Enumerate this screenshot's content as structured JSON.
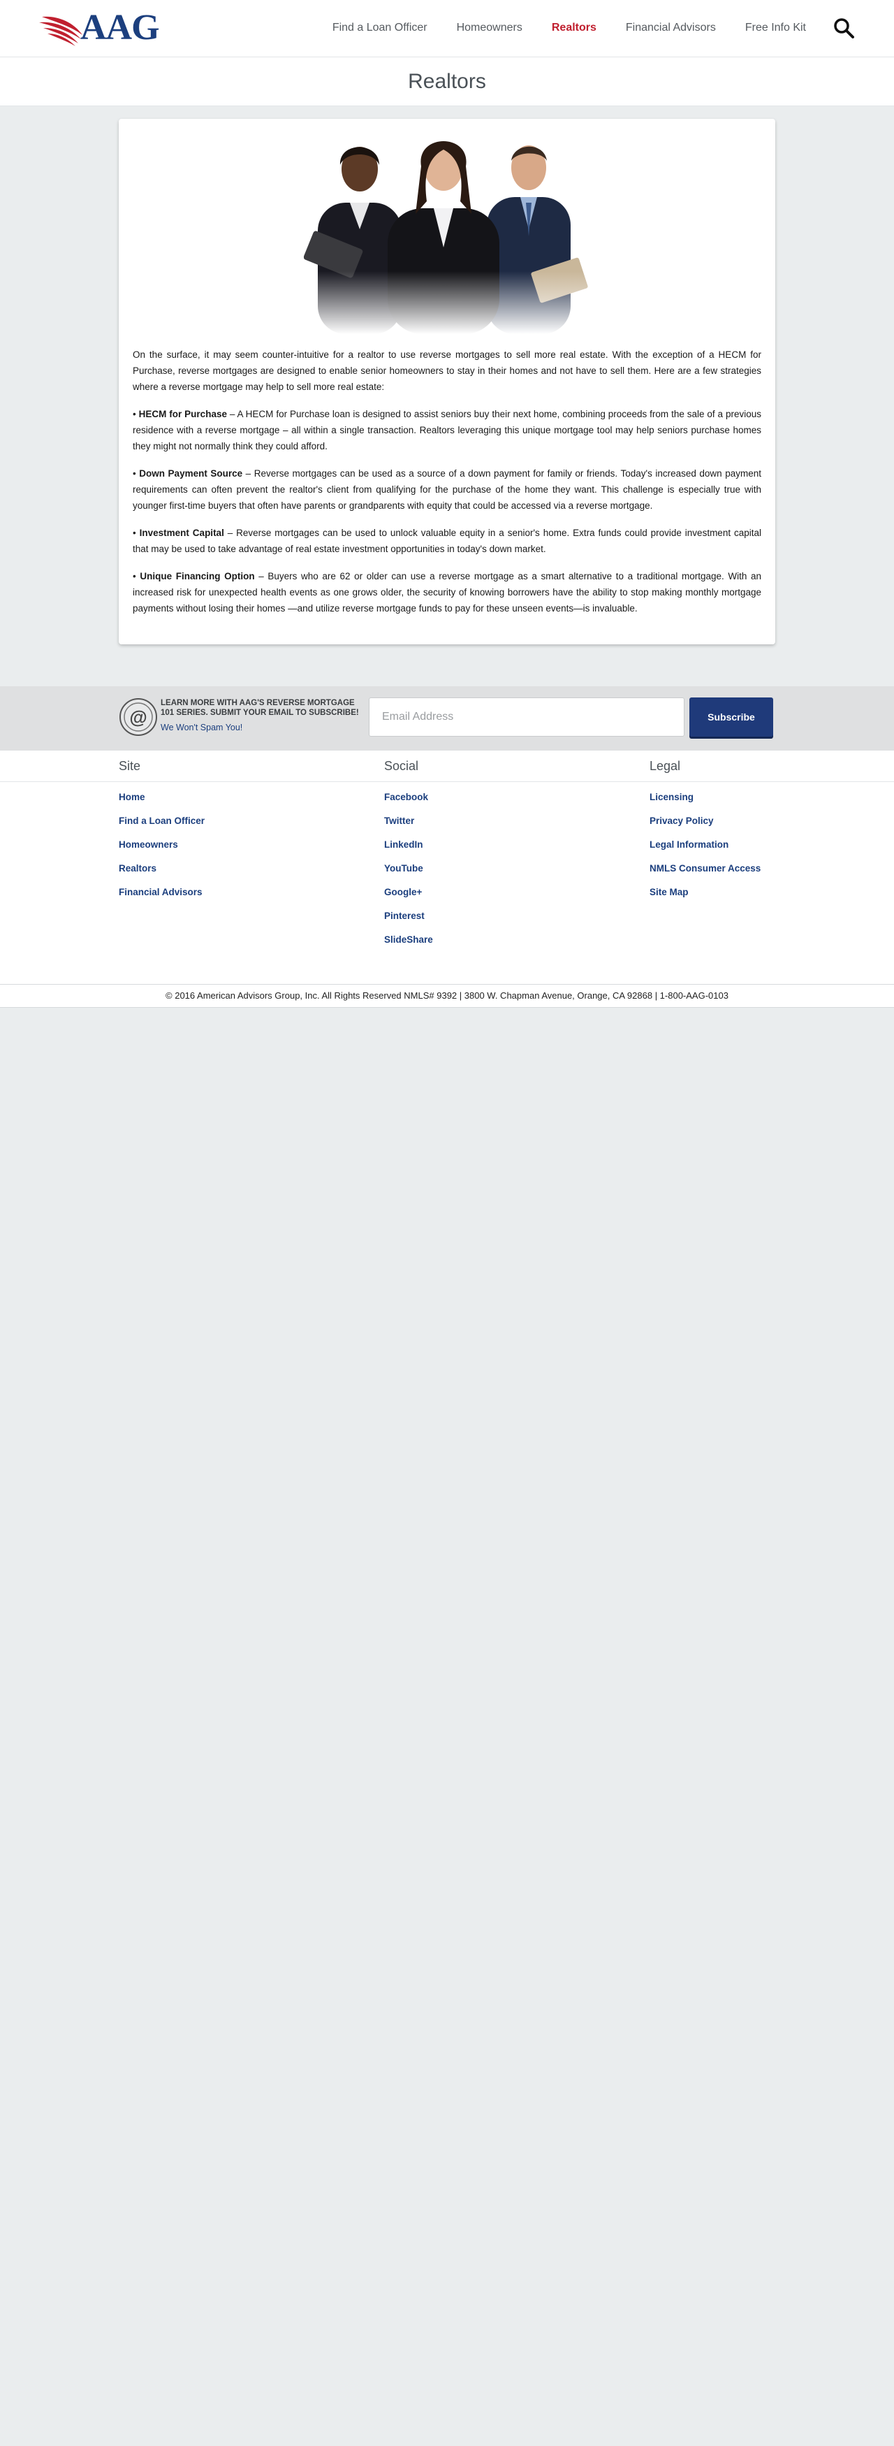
{
  "header": {
    "logo_text": "AAG",
    "nav": [
      {
        "label": "Find a Loan Officer",
        "active": false
      },
      {
        "label": "Homeowners",
        "active": false
      },
      {
        "label": "Realtors",
        "active": true
      },
      {
        "label": "Financial Advisors",
        "active": false
      },
      {
        "label": "Free Info Kit",
        "active": false
      }
    ],
    "search_icon": "search-icon"
  },
  "page": {
    "title": "Realtors"
  },
  "article": {
    "intro": "On the surface, it may seem counter-intuitive for a realtor to use reverse mortgages to sell more real estate. With the exception of a HECM for Purchase, reverse mortgages are designed to enable senior homeowners to stay in their homes and not have to sell them. Here are a few strategies where a reverse mortgage may help to sell more real estate:",
    "items": [
      {
        "bullet": "•",
        "heading": "HECM for Purchase",
        "text": " – A HECM for Purchase loan is designed to assist seniors buy their next home, combining proceeds from the sale of a previous residence with a reverse mortgage – all within a single transaction. Realtors leveraging this unique mortgage tool may help seniors purchase homes they might not normally think they could afford."
      },
      {
        "bullet": "•",
        "heading": "Down Payment Source",
        "text": " – Reverse mortgages can be used as a source of a down payment for family or friends. Today's increased down payment requirements can often prevent the realtor's client from qualifying for the purchase of the home they want. This challenge is especially true with younger first-time buyers that often have parents or grandparents with equity that could be accessed via a reverse mortgage."
      },
      {
        "bullet": "•",
        "heading": "Investment Capital",
        "text": " – Reverse mortgages can be used to unlock valuable equity in a senior's home. Extra funds could provide investment capital that may be used to take advantage of real estate investment opportunities in today's down market."
      },
      {
        "bullet": "•",
        "heading": "Unique Financing Option",
        "text": " – Buyers who are 62 or older can use a reverse mortgage as a smart alternative to a traditional mortgage. With an increased risk for unexpected health events as one grows older, the security of knowing borrowers have the ability to stop making monthly mortgage payments without losing their homes —and utilize reverse mortgage funds to pay for these unseen events—is invaluable."
      }
    ]
  },
  "subscribe": {
    "heading": "Learn more with AAG's Reverse Mortgage 101 series. Submit your email to subscribe!",
    "no_spam": "We Won't Spam You!",
    "email_placeholder": "Email Address",
    "button_label": "Subscribe"
  },
  "footer": {
    "columns": [
      {
        "title": "Site",
        "links": [
          "Home",
          "Find a Loan Officer",
          "Homeowners",
          "Realtors",
          "Financial Advisors"
        ]
      },
      {
        "title": "Social",
        "links": [
          "Facebook",
          "Twitter",
          "LinkedIn",
          "YouTube",
          "Google+",
          "Pinterest",
          "SlideShare"
        ]
      },
      {
        "title": "Legal",
        "links": [
          "Licensing",
          "Privacy Policy",
          "Legal Information",
          "NMLS Consumer Access",
          "Site Map"
        ]
      }
    ],
    "copyright": "© 2016 American Advisors Group, Inc. All Rights Reserved NMLS# 9392 | 3800 W. Chapman Avenue, Orange, CA 92868 | 1-800-AAG-0103"
  },
  "colors": {
    "brand_blue": "#1c3f7e",
    "brand_red": "#c0202f",
    "page_bg": "#eaedee"
  }
}
